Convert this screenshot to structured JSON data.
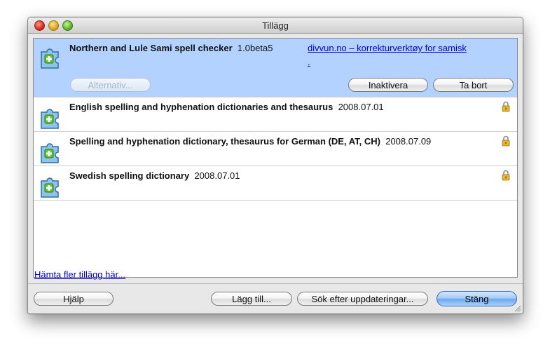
{
  "window": {
    "title": "Tillägg"
  },
  "addons": [
    {
      "name": "Northern and Lule Sami spell checker",
      "version": "1.0beta5",
      "homepage": "divvun.no – korrekturverktøy for samisk",
      "homepage_tail": ".",
      "selected": true,
      "buttons": {
        "options": "Alternativ...",
        "disable": "Inaktivera",
        "remove": "Ta bort"
      }
    },
    {
      "name": "English spelling and hyphenation dictionaries and thesaurus",
      "version": "2008.07.01",
      "locked": true
    },
    {
      "name": "Spelling and hyphenation dictionary, thesaurus for German (DE, AT, CH)",
      "version": "2008.07.09",
      "locked": true
    },
    {
      "name": "Swedish spelling dictionary",
      "version": "2008.07.01",
      "locked": true
    }
  ],
  "get_more_link": "Hämta fler tillägg här...",
  "footer": {
    "help": "Hjälp",
    "add": "Lägg till...",
    "check_updates": "Sök efter uppdateringar...",
    "close": "Stäng"
  },
  "icons": {
    "addon": "puzzle-plus-icon",
    "lock": "padlock-icon"
  },
  "colors": {
    "selection": "#b3d2ff",
    "link": "#0000cc",
    "primary_button": "#6ea9ec",
    "icon_blue": "#4a8fc7",
    "icon_green": "#4fbf2a"
  }
}
